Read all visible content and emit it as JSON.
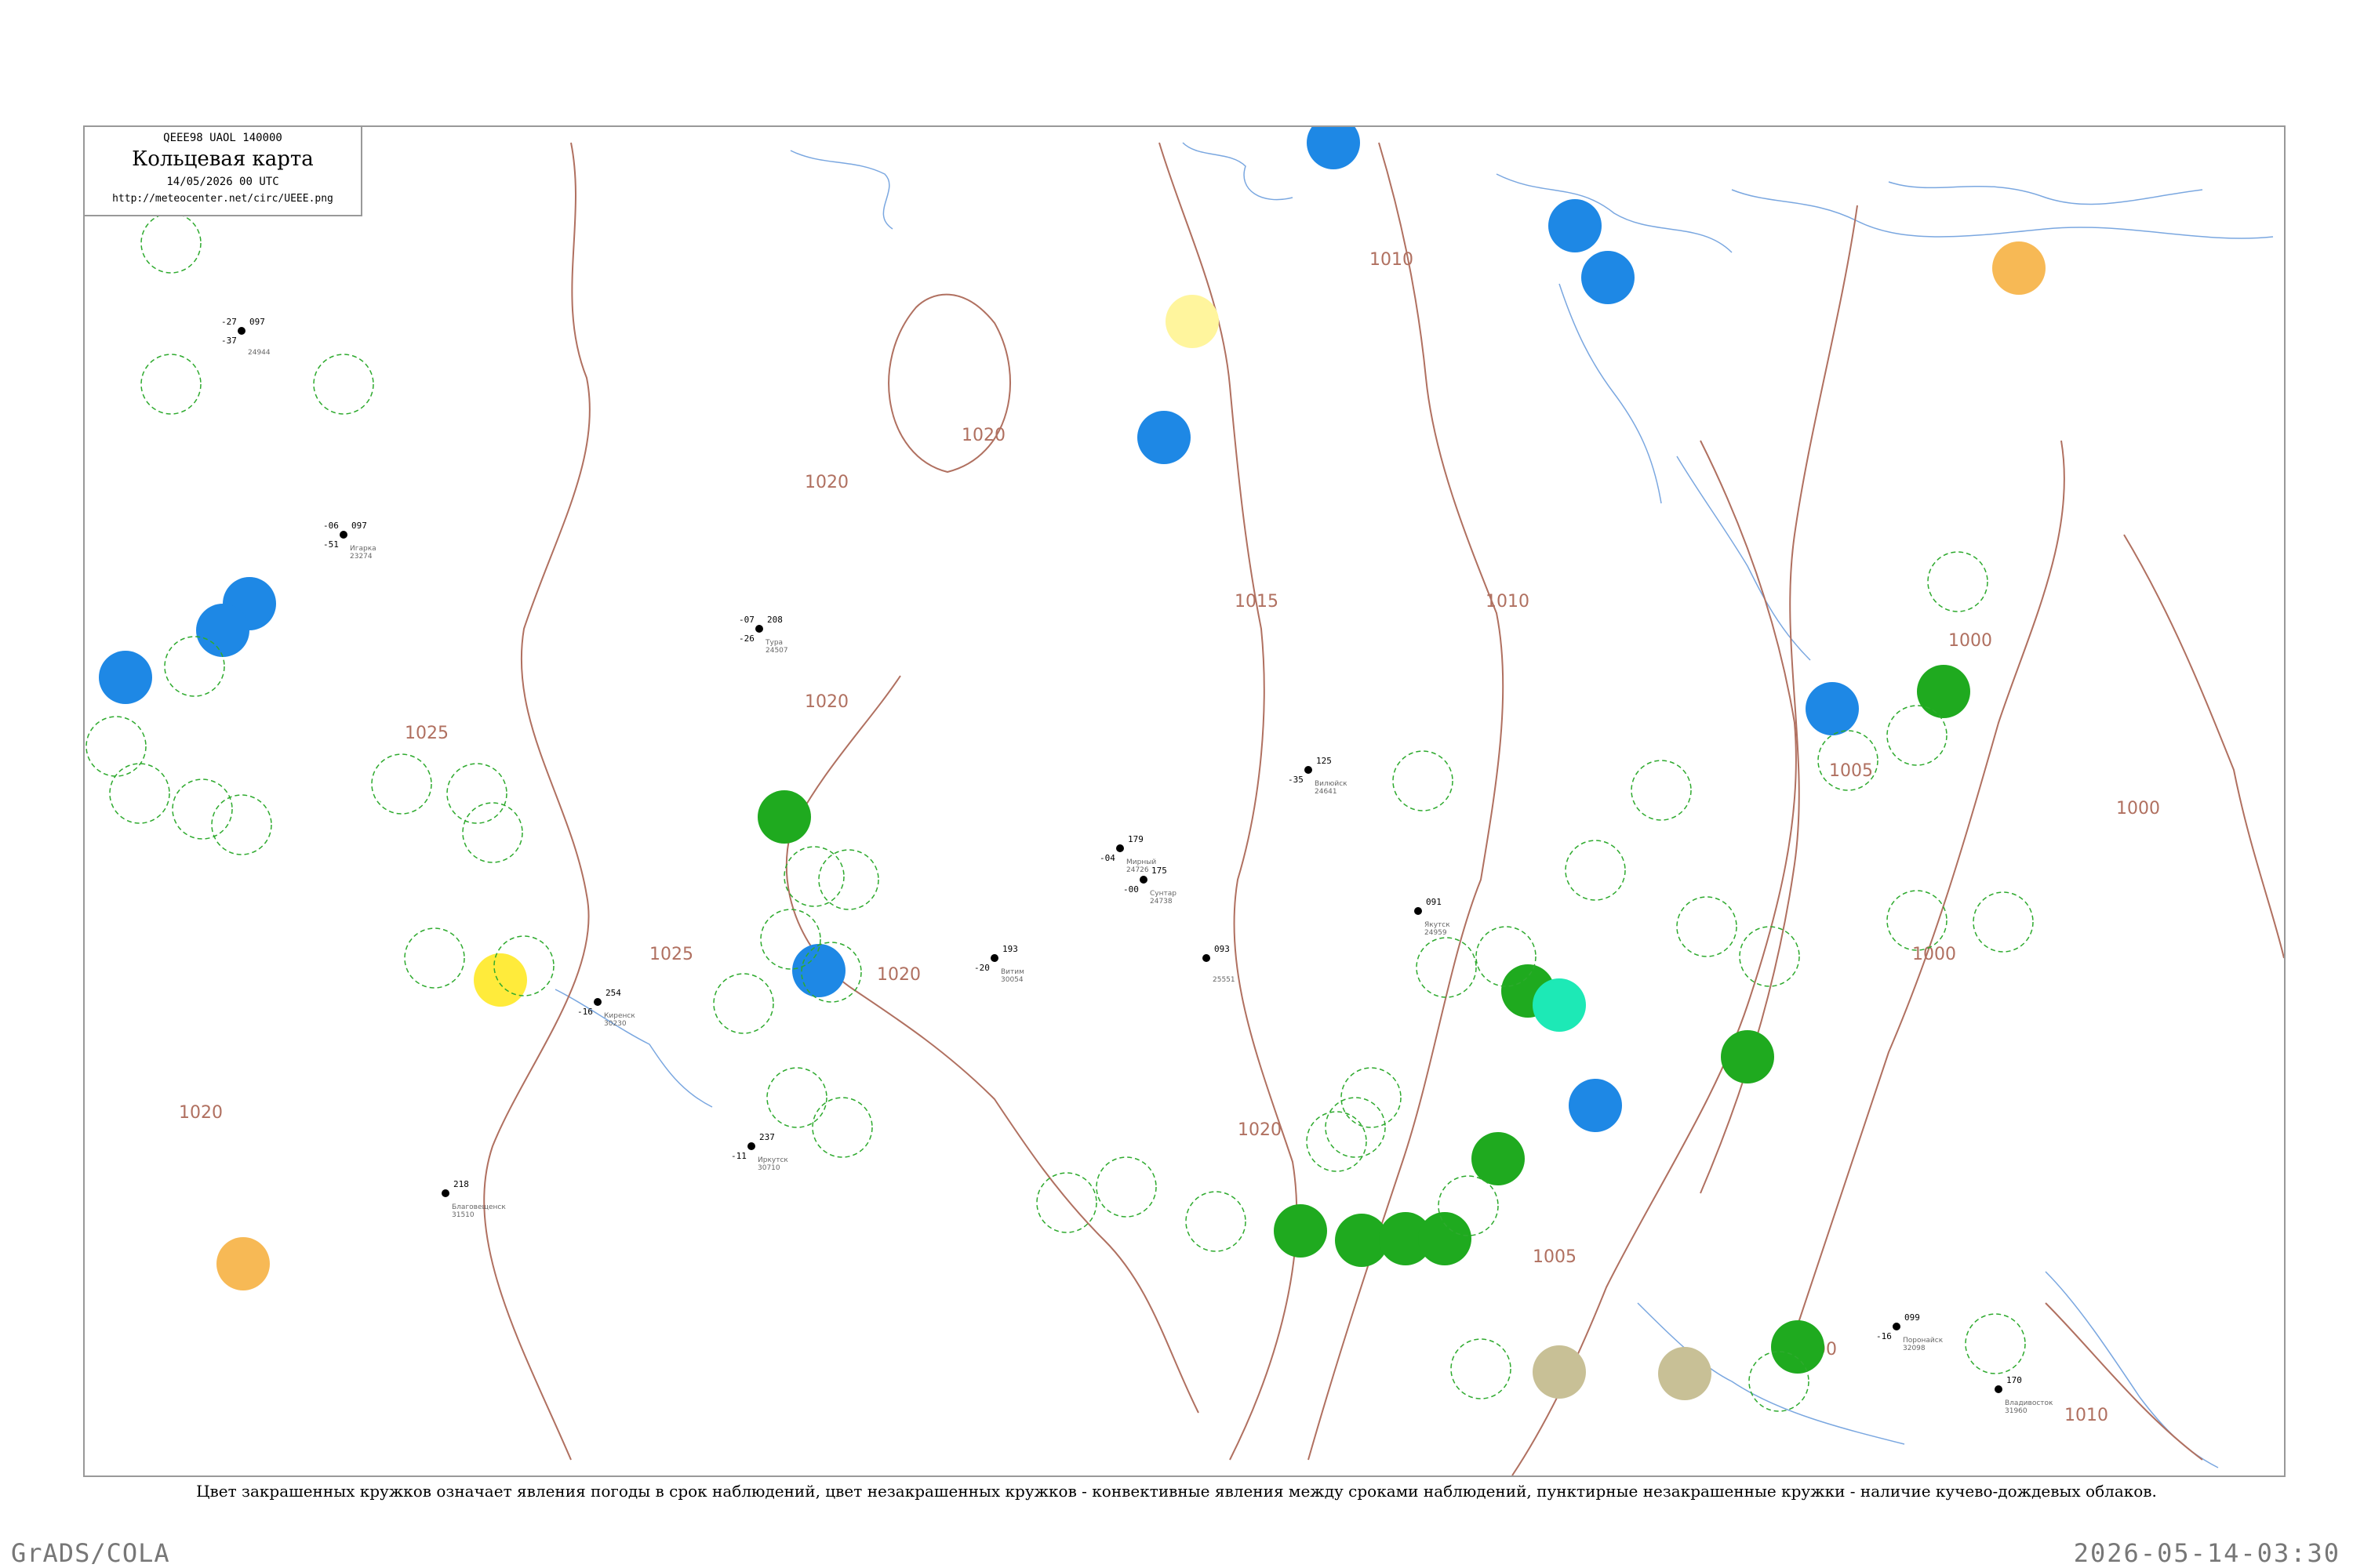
{
  "header": {
    "code": "QEEE98  UAOL  140000",
    "title": "Кольцевая карта",
    "datetime": "14/05/2026 00 UTC",
    "url": "http://meteocenter.net/circ/UEEE.png"
  },
  "caption": "Цвет закрашенных кружков означает явления погоды в срок наблюдений, цвет незакрашенных кружков - конвективные явления между сроками наблюдений, пунктирные незакрашенные кружки - наличие кучево-дождевых облаков.",
  "footer": {
    "left": "GrADS/COLA",
    "right": "2026-05-14-03:30"
  },
  "isobars": [
    {
      "label": "1020"
    },
    {
      "label": "1020"
    },
    {
      "label": "1020"
    },
    {
      "label": "1020"
    },
    {
      "label": "1025"
    },
    {
      "label": "1025"
    },
    {
      "label": "1020"
    },
    {
      "label": "1020"
    },
    {
      "label": "1015"
    },
    {
      "label": "1010"
    },
    {
      "label": "1010"
    },
    {
      "label": "1005"
    },
    {
      "label": "1000"
    },
    {
      "label": "1000"
    },
    {
      "label": "1000"
    },
    {
      "label": "1005"
    },
    {
      "label": "1000"
    },
    {
      "label": "1010"
    }
  ],
  "colors": {
    "rain": "#1e88e5",
    "thunder": "#1faa1f",
    "showers_teal": "#1de9b6",
    "fog_yellow": "#ffeb3b",
    "pale_yellow": "#fff59d",
    "orange": "#f7b955",
    "khaki": "#c8c096",
    "cb_ring": "#2eaa2e",
    "isobar": "#b07060",
    "water": "#7aa7e0"
  },
  "stations": [
    {
      "id": "24944",
      "name": "",
      "t": "-27",
      "p": "097",
      "td": "-37"
    },
    {
      "id": "23274",
      "name": "Игарка",
      "t": "-06",
      "p": "097",
      "td": "-51"
    },
    {
      "id": "24959",
      "name": "Якутск",
      "t": "",
      "p": "091",
      "td": ""
    },
    {
      "id": "25551",
      "name": "",
      "t": "",
      "p": "093",
      "td": ""
    },
    {
      "id": "24507",
      "name": "Тура",
      "t": "-07",
      "p": "208",
      "td": "-26"
    },
    {
      "id": "24641",
      "name": "Вилюйск",
      "t": "",
      "p": "125",
      "td": "-35"
    },
    {
      "id": "24726",
      "name": "Мирный",
      "t": "",
      "p": "179",
      "td": "-04"
    },
    {
      "id": "24738",
      "name": "Сунтар",
      "t": "",
      "p": "175",
      "td": "-00"
    },
    {
      "id": "30054",
      "name": "Витим",
      "t": "",
      "p": "193",
      "td": "-20"
    },
    {
      "id": "30230",
      "name": "Киренск",
      "t": "",
      "p": "254",
      "td": "-16"
    },
    {
      "id": "30710",
      "name": "Иркутск",
      "t": "",
      "p": "237",
      "td": "-11"
    },
    {
      "id": "31510",
      "name": "Благовещенск",
      "t": "",
      "p": "218",
      "td": ""
    },
    {
      "id": "32098",
      "name": "Поронайск",
      "t": "",
      "p": "099",
      "td": "-16"
    },
    {
      "id": "31960",
      "name": "Владивосток",
      "t": "",
      "p": "170",
      "td": ""
    }
  ]
}
